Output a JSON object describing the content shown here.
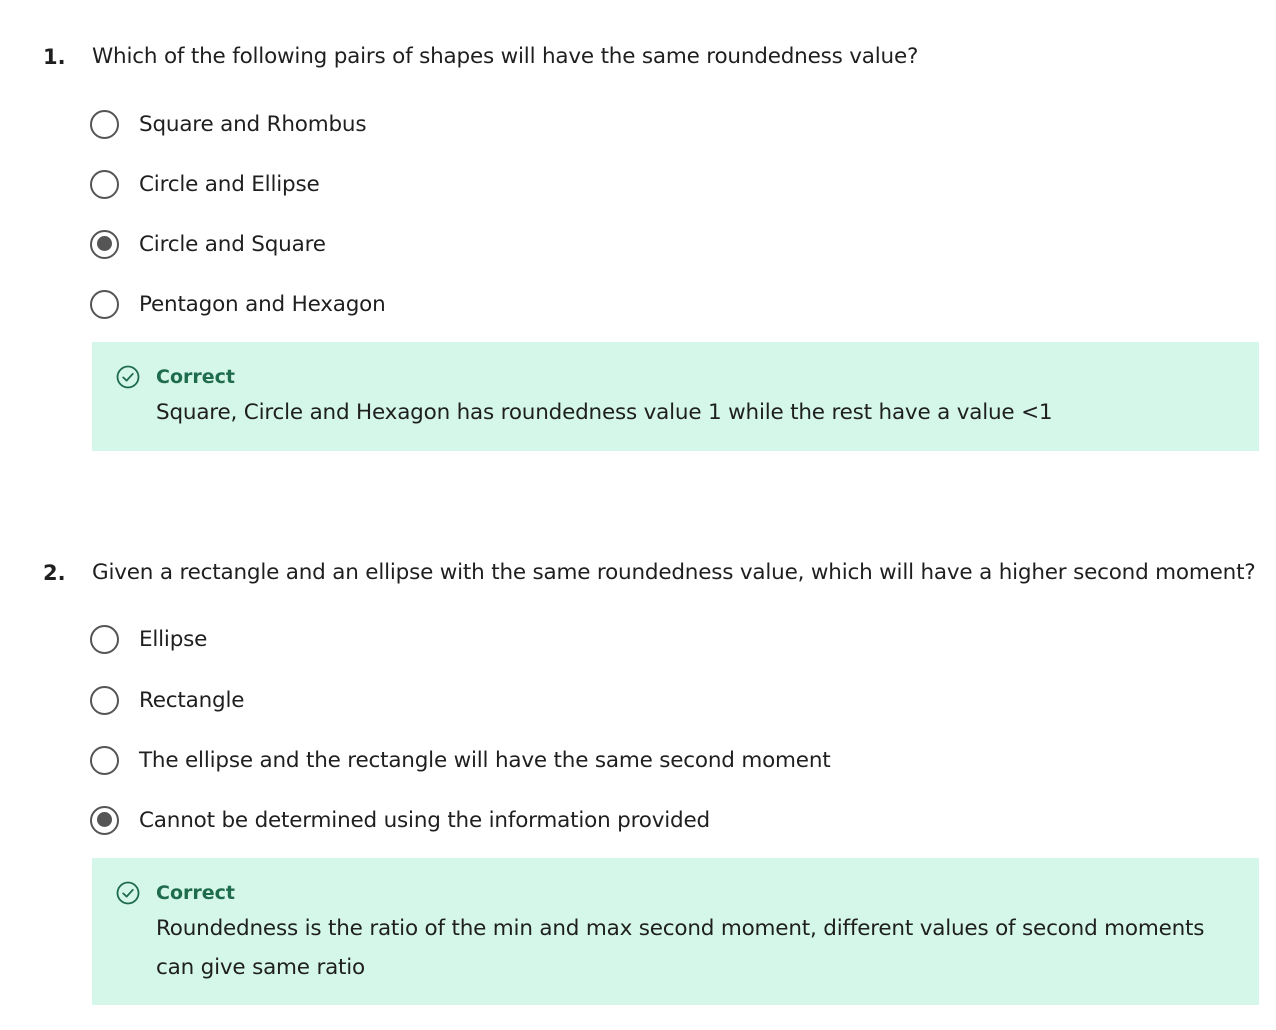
{
  "questions": [
    {
      "number": "1.",
      "text": "Which of the following pairs of shapes will have the same roundedness value?",
      "options": [
        {
          "label": "Square and Rhombus",
          "selected": false
        },
        {
          "label": "Circle and Ellipse",
          "selected": false
        },
        {
          "label": "Circle and Square",
          "selected": true
        },
        {
          "label": "Pentagon and Hexagon",
          "selected": false
        }
      ],
      "feedback": {
        "status": "Correct",
        "icon": "check-circle-icon",
        "explanation": "Square, Circle and Hexagon has roundedness value 1 while the rest have a value <1"
      }
    },
    {
      "number": "2.",
      "text": "Given a rectangle and an ellipse with the same roundedness value, which will have a higher second moment?",
      "options": [
        {
          "label": "Ellipse",
          "selected": false
        },
        {
          "label": "Rectangle",
          "selected": false
        },
        {
          "label": "The ellipse and the rectangle will have the same second moment",
          "selected": false
        },
        {
          "label": "Cannot be determined using the information provided",
          "selected": true
        }
      ],
      "feedback": {
        "status": "Correct",
        "icon": "check-circle-icon",
        "explanation": "Roundedness is the ratio of the min and max second moment, different values of second moments can give same ratio"
      }
    }
  ],
  "colors": {
    "feedback_background": "#d4f7ea",
    "correct_green": "#1f6b4d",
    "radio_gray": "#555555"
  }
}
